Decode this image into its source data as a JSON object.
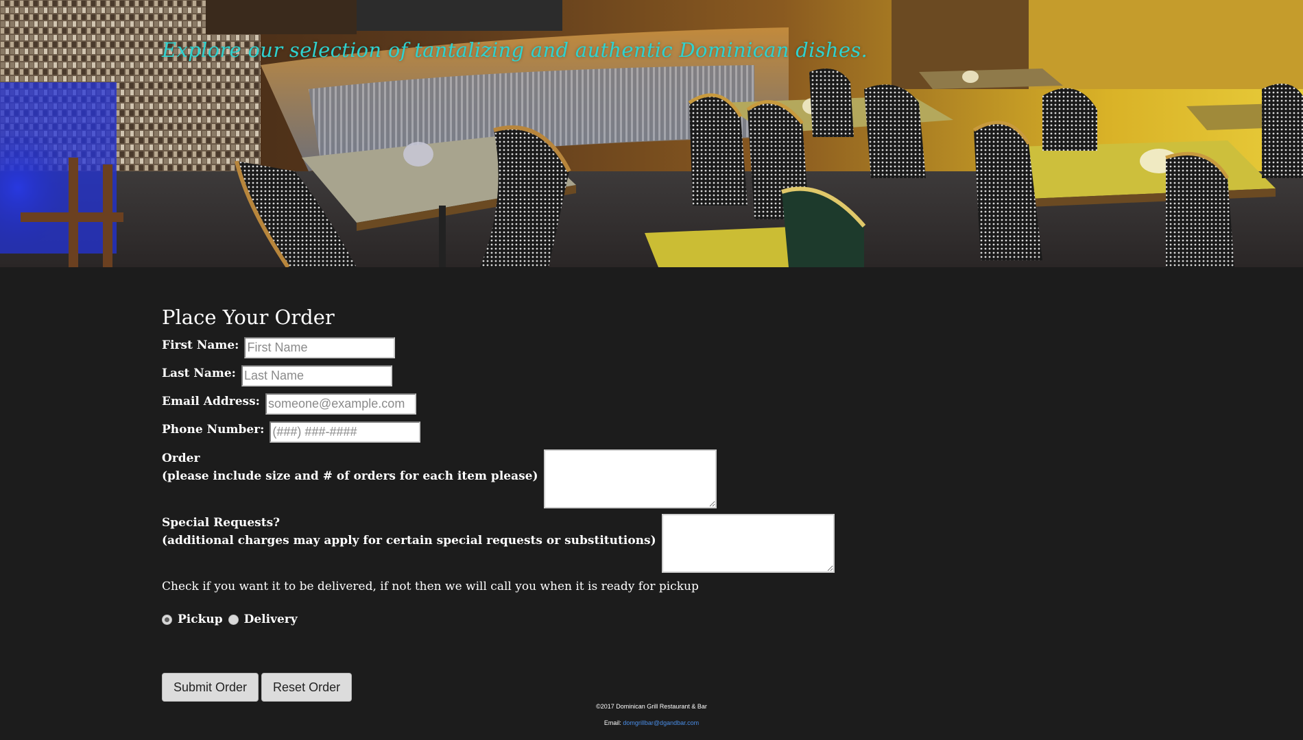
{
  "hero": {
    "tagline": "Explore our selection of tantalizing and authentic Dominican dishes.",
    "image_description": "restaurant-interior-photo"
  },
  "order_form": {
    "title": "Place Your Order",
    "first_name": {
      "label": "First Name:",
      "placeholder": "First Name",
      "value": ""
    },
    "last_name": {
      "label": "Last Name:",
      "placeholder": "Last Name",
      "value": ""
    },
    "email": {
      "label": "Email Address:",
      "placeholder": "someone@example.com",
      "value": ""
    },
    "phone": {
      "label": "Phone Number:",
      "placeholder": "(###) ###-####",
      "value": ""
    },
    "order": {
      "label_line1": "Order",
      "label_line2": "(please include size and # of orders for each item please)",
      "value": ""
    },
    "special_requests": {
      "label_line1": "Special Requests?",
      "label_line2": "(additional charges may apply for certain special requests or substitutions)",
      "value": ""
    },
    "delivery_note": "Check if you want it to be delivered, if not then we will call you when it is ready for pickup",
    "radios": [
      {
        "label": "Pickup",
        "checked": true
      },
      {
        "label": "Delivery",
        "checked": false
      }
    ],
    "submit_label": "Submit Order",
    "reset_label": "Reset Order"
  },
  "footer": {
    "copyright": "©2017 Dominican Grill Restaurant & Bar",
    "email_label": "Email:",
    "email_address": "domgrillbar@dgandbar.com"
  },
  "colors": {
    "page_background": "#1c1c1c",
    "tagline": "#2fd2cf",
    "link": "#4a8ee8",
    "button": "#dcdcdc"
  }
}
